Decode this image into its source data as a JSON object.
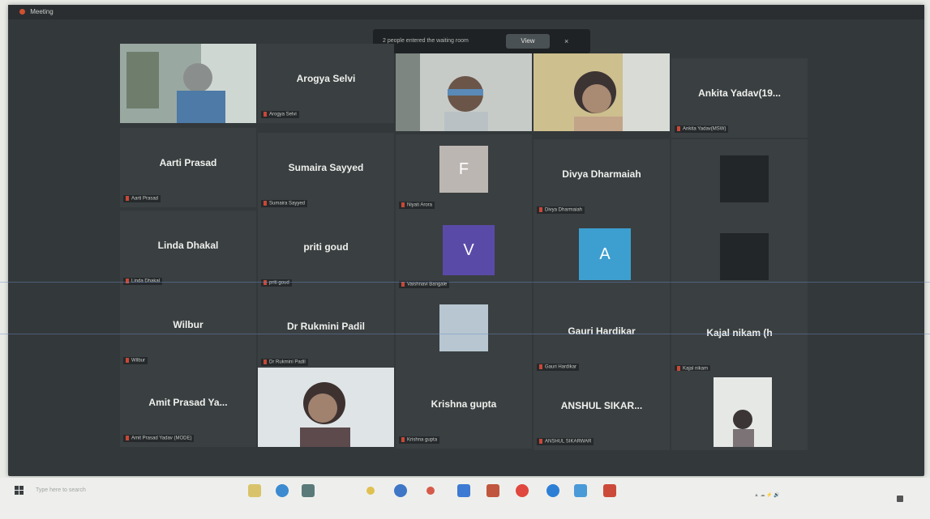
{
  "window": {
    "title": "Meeting"
  },
  "banner": {
    "text": "2 people entered the waiting room",
    "view_label": "View",
    "close_label": "×"
  },
  "participants": [
    {
      "label": "",
      "display": "",
      "video": true
    },
    {
      "label": "Arogya Selvi",
      "display": "Arogya Selvi",
      "video": false
    },
    {
      "label": "",
      "display": "",
      "video": true
    },
    {
      "label": "",
      "display": "",
      "video": true
    },
    {
      "label": "Ankita Yadav(MSW)",
      "display": "Ankita Yadav(19...",
      "video": false
    },
    {
      "label": "Aarti Prasad",
      "display": "Aarti Prasad",
      "video": false
    },
    {
      "label": "Sumaira Sayyed",
      "display": "Sumaira Sayyed",
      "video": false
    },
    {
      "label": "Niyati Arora",
      "display": "",
      "avatar": "F",
      "avatar_color": "#bcb6b2"
    },
    {
      "label": "Divya Dharmaiah",
      "display": "Divya Dharmaiah",
      "video": false
    },
    {
      "label": "",
      "display": "",
      "avatar": "",
      "avatar_color": "#232628"
    },
    {
      "label": "Linda Dhakal",
      "display": "Linda Dhakal",
      "video": false
    },
    {
      "label": "priti goud",
      "display": "priti goud",
      "video": false
    },
    {
      "label": "Vaishnavi Bangale",
      "display": "",
      "avatar": "V",
      "avatar_color": "#5a4aa8"
    },
    {
      "label": "",
      "display": "",
      "avatar": "A",
      "avatar_color": "#3d9fd0"
    },
    {
      "label": "",
      "display": "",
      "avatar": "",
      "avatar_color": "#232628"
    },
    {
      "label": "Wilbur",
      "display": "Wilbur",
      "video": false
    },
    {
      "label": "Dr Rukmini Padil",
      "display": "Dr Rukmini Padil",
      "video": false
    },
    {
      "label": "",
      "display": "",
      "avatar": "",
      "avatar_color": "#b7c6d0"
    },
    {
      "label": "Gauri Hardikar",
      "display": "Gauri Hardikar",
      "video": false
    },
    {
      "label": "Kajal nikam",
      "display": "Kajal nikam (h",
      "video": false
    },
    {
      "label": "Amit Prasad Yadav (MODE)",
      "display": "Amit Prasad Ya...",
      "video": false
    },
    {
      "label": "",
      "display": "",
      "video": true
    },
    {
      "label": "Krishna gupta",
      "display": "Krishna gupta",
      "video": false
    },
    {
      "label": "ANSHUL SIKARWAR",
      "display": "ANSHUL SIKAR...",
      "video": false
    },
    {
      "label": "",
      "display": "",
      "video": true
    }
  ],
  "taskbar": {
    "search_placeholder": "Type here to search",
    "icons": [
      "file-explorer-icon",
      "edge-icon",
      "store-icon",
      "weather-icon",
      "chrome-icon",
      "mail-icon",
      "teams-icon",
      "photos-icon",
      "opera-icon",
      "zoom-icon",
      "settings-icon",
      "powerpoint-icon"
    ]
  }
}
